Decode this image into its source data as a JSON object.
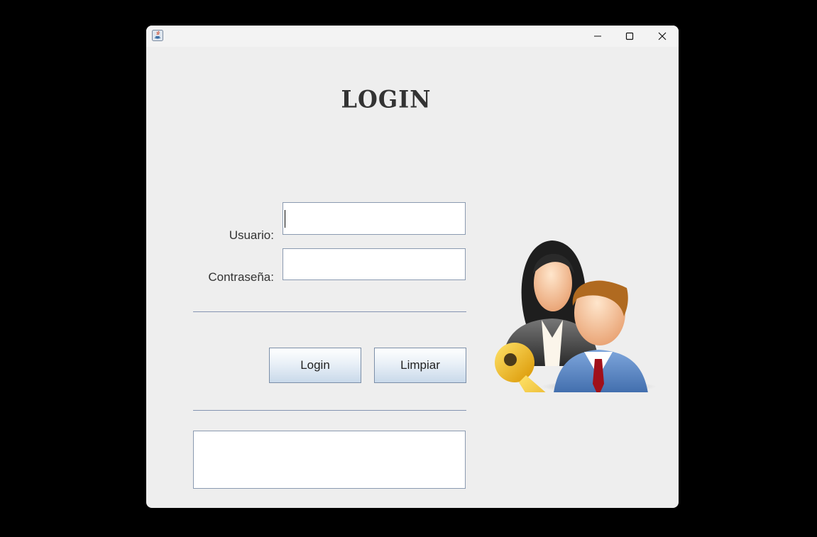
{
  "window": {
    "app_icon": "java-icon",
    "controls": [
      "minimize-icon",
      "maximize-icon",
      "close-icon"
    ]
  },
  "form": {
    "title": "LOGIN",
    "username_label": "Usuario:",
    "username_value": "",
    "password_label": "Contraseña:",
    "password_value": "",
    "login_button": "Login",
    "clear_button": "Limpiar",
    "message": ""
  },
  "illustration": {
    "icon": "users-key-icon"
  },
  "colors": {
    "window_bg": "#eeeeee",
    "separator": "#8594b2",
    "field_border": "#8a9ab0"
  }
}
